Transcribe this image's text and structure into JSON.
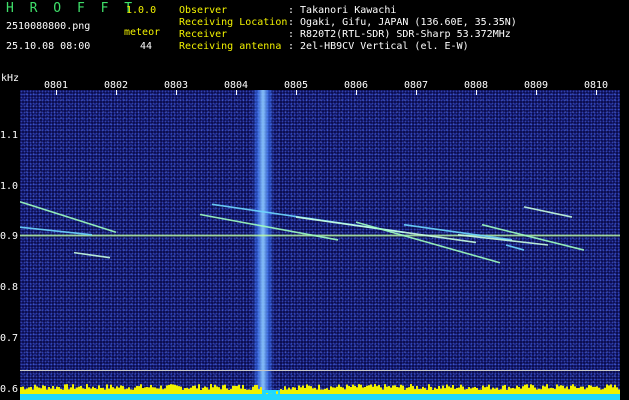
{
  "header": {
    "app_name": "H R O F F T",
    "version": "1.0.0",
    "filename": "2510080800.png",
    "datetime": "25.10.08 08:00",
    "meteor_label": "meteor",
    "meteor_count": "44",
    "info": [
      {
        "label": "Observer",
        "value": ": Takanori Kawachi"
      },
      {
        "label": "Receiving Location",
        "value": ": Ogaki, Gifu, JAPAN (136.60E, 35.35N)"
      },
      {
        "label": "Receiver",
        "value": ": R820T2(RTL-SDR) SDR-Sharp 53.372MHz"
      },
      {
        "label": "Receiving antenna",
        "value": ": 2el-HB9CV Vertical (el. E-W)"
      }
    ]
  },
  "colors": {
    "title_green": "#3fe06a",
    "text_yellow": "#f2f200",
    "background": "#000000",
    "plot_blue": "#0a0a4a"
  },
  "chart_data": {
    "type": "heatmap",
    "ylabel": "kHz",
    "y_ticks": [
      "1.1",
      "1.0",
      "0.9",
      "0.8",
      "0.7",
      "0.6"
    ],
    "x_ticks": [
      "0801",
      "0802",
      "0803",
      "0804",
      "0805",
      "0806",
      "0807",
      "0808",
      "0809",
      "0810"
    ],
    "ylim": [
      0.58,
      1.19
    ],
    "xlim": [
      0,
      10
    ],
    "carrier_khz": 0.905,
    "interference_minute": 4.05,
    "meteor_traces": [
      {
        "start": [
          0.0,
          0.97
        ],
        "end": [
          1.6,
          0.91
        ]
      },
      {
        "start": [
          0.0,
          0.92
        ],
        "end": [
          1.2,
          0.905
        ]
      },
      {
        "start": [
          0.9,
          0.87
        ],
        "end": [
          1.5,
          0.86
        ]
      },
      {
        "start": [
          3.0,
          0.945
        ],
        "end": [
          5.3,
          0.895
        ]
      },
      {
        "start": [
          3.2,
          0.965
        ],
        "end": [
          6.4,
          0.91
        ]
      },
      {
        "start": [
          4.6,
          0.94
        ],
        "end": [
          7.6,
          0.89
        ]
      },
      {
        "start": [
          5.6,
          0.93
        ],
        "end": [
          8.0,
          0.85
        ]
      },
      {
        "start": [
          6.4,
          0.925
        ],
        "end": [
          8.2,
          0.895
        ]
      },
      {
        "start": [
          7.3,
          0.905
        ],
        "end": [
          8.8,
          0.885
        ]
      },
      {
        "start": [
          7.7,
          0.925
        ],
        "end": [
          9.4,
          0.875
        ]
      },
      {
        "start": [
          8.1,
          0.885
        ],
        "end": [
          8.4,
          0.875
        ]
      },
      {
        "start": [
          8.4,
          0.96
        ],
        "end": [
          9.2,
          0.94
        ]
      }
    ]
  }
}
